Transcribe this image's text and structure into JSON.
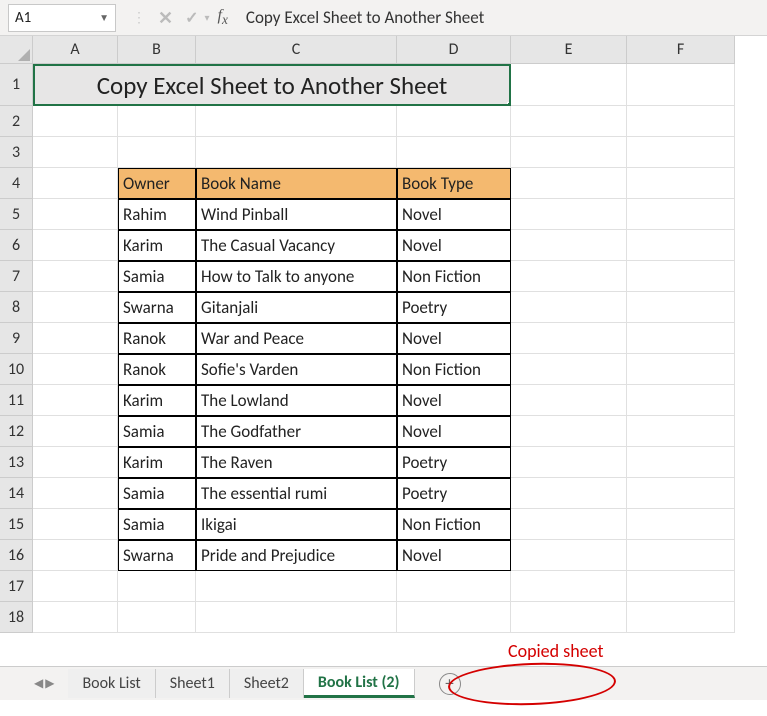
{
  "name_box": "A1",
  "formula_bar": "Copy Excel Sheet to Another Sheet",
  "columns": [
    "A",
    "B",
    "C",
    "D",
    "E",
    "F"
  ],
  "rows": [
    "1",
    "2",
    "3",
    "4",
    "5",
    "6",
    "7",
    "8",
    "9",
    "10",
    "11",
    "12",
    "13",
    "14",
    "15",
    "16",
    "17",
    "18"
  ],
  "title": "Copy Excel Sheet to Another Sheet",
  "table": {
    "headers": {
      "owner": "Owner",
      "book_name": "Book Name",
      "book_type": "Book Type"
    },
    "rows": [
      {
        "owner": "Rahim",
        "book_name": "Wind Pinball",
        "book_type": "Novel"
      },
      {
        "owner": "Karim",
        "book_name": "The Casual Vacancy",
        "book_type": "Novel"
      },
      {
        "owner": "Samia",
        "book_name": "How to Talk to anyone",
        "book_type": "Non Fiction"
      },
      {
        "owner": "Swarna",
        "book_name": "Gitanjali",
        "book_type": "Poetry"
      },
      {
        "owner": "Ranok",
        "book_name": "War and Peace",
        "book_type": "Novel"
      },
      {
        "owner": "Ranok",
        "book_name": "Sofie's Varden",
        "book_type": "Non Fiction"
      },
      {
        "owner": "Karim",
        "book_name": "The Lowland",
        "book_type": "Novel"
      },
      {
        "owner": "Samia",
        "book_name": "The Godfather",
        "book_type": "Novel"
      },
      {
        "owner": "Karim",
        "book_name": "The Raven",
        "book_type": "Poetry"
      },
      {
        "owner": "Samia",
        "book_name": "The essential rumi",
        "book_type": "Poetry"
      },
      {
        "owner": "Samia",
        "book_name": "Ikigai",
        "book_type": "Non Fiction"
      },
      {
        "owner": "Swarna",
        "book_name": "Pride and Prejudice",
        "book_type": "Novel"
      }
    ]
  },
  "tabs": [
    {
      "label": "Book List",
      "active": false
    },
    {
      "label": "Sheet1",
      "active": false
    },
    {
      "label": "Sheet2",
      "active": false
    },
    {
      "label": "Book List (2)",
      "active": true
    }
  ],
  "annotation": "Copied sheet"
}
